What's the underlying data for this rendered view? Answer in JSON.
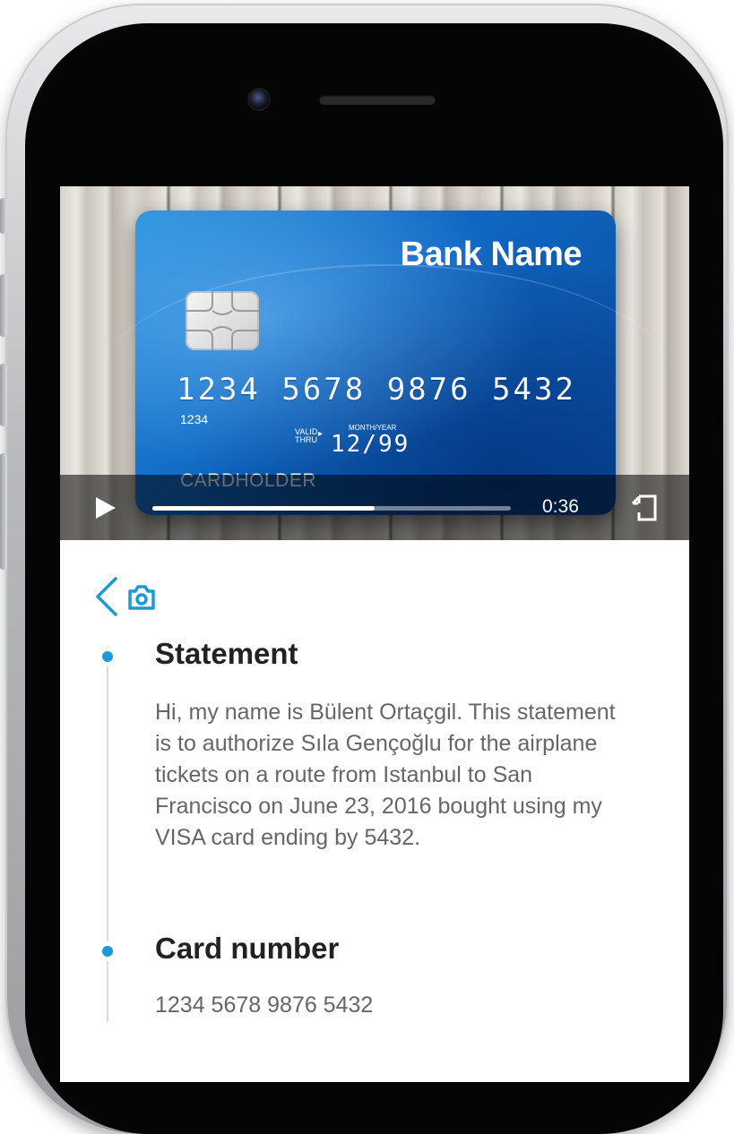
{
  "card": {
    "bank_name": "Bank Name",
    "number": "1234 5678 9876 5432",
    "small_code": "1234",
    "valid_label": "VALID THRU",
    "month_year_label": "MONTH/YEAR",
    "expiry": "12/99",
    "cardholder": "CARDHOLDER"
  },
  "player": {
    "time": "0:36",
    "progress": 0.62,
    "play_icon": "play-icon",
    "fullscreen_icon": "fullscreen-icon"
  },
  "toolbar": {
    "back_icon": "chevron-left-icon",
    "camera_icon": "camera-icon",
    "accent": "#1d9ad6"
  },
  "sections": [
    {
      "title": "Statement",
      "body": "Hi, my name is Bülent Ortaçgil. This statement is to authorize Sıla Gençoğlu for the airplane tickets on a route from Istanbul to San Francisco on June 23, 2016 bought using my VISA card ending by 5432."
    },
    {
      "title": "Card number",
      "body": "1234 5678 9876 5432"
    }
  ]
}
